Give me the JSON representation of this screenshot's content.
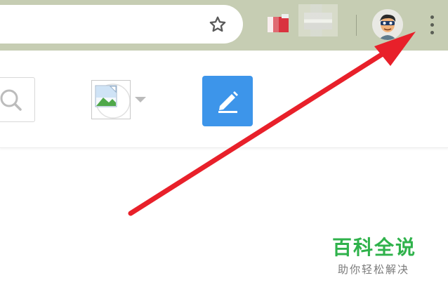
{
  "browser": {
    "toolbar_color": "#c6cdb3",
    "bookmark_icon": "star-outline-icon",
    "menu_icon": "vertical-dots-icon",
    "avatar_icon": "cartoon-avatar-icon"
  },
  "page": {
    "search_icon": "search-icon",
    "image_icon": "image-placeholder-icon",
    "dropdown_icon": "caret-down-icon",
    "edit_icon": "pencil-icon",
    "edit_button_color": "#3d95ea"
  },
  "annotation": {
    "arrow_color": "#e8202a"
  },
  "watermark": {
    "title": "百科全说",
    "subtitle": "助你轻松解决",
    "title_color": "#2fb24b"
  }
}
